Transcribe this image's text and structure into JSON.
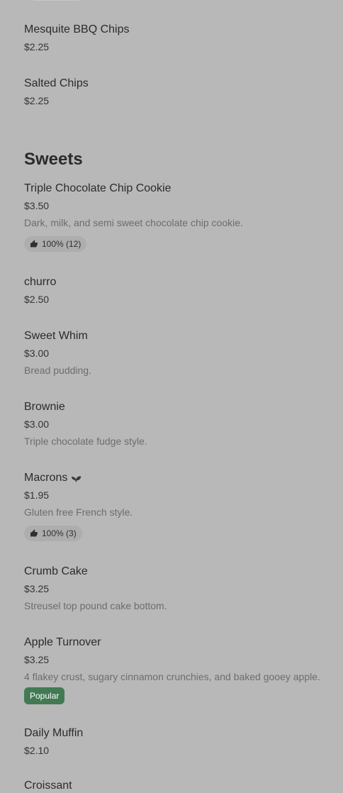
{
  "items_before": [
    {
      "name": "Mesquite BBQ Chips",
      "price": "$2.25"
    },
    {
      "name": "Salted Chips",
      "price": "$2.25"
    }
  ],
  "section": {
    "title": "Sweets"
  },
  "sweets": [
    {
      "name": "Triple Chocolate Chip Cookie",
      "price": "$3.50",
      "description": "Dark, milk, and semi sweet chocolate chip cookie.",
      "rating": "100% (12)"
    },
    {
      "name": "churro",
      "price": "$2.50"
    },
    {
      "name": "Sweet Whim",
      "price": "$3.00",
      "description": "Bread pudding."
    },
    {
      "name": "Brownie",
      "price": "$3.00",
      "description": "Triple chocolate fudge style."
    },
    {
      "name": "Macrons",
      "price": "$1.95",
      "description": "Gluten free French style.",
      "rating": "100% (3)",
      "icon": "leaf-icon"
    },
    {
      "name": "Crumb Cake",
      "price": "$3.25",
      "description": "Streusel top pound cake bottom."
    },
    {
      "name": "Apple Turnover",
      "price": "$3.25",
      "description": "4 flakey crust, sugary cinnamon crunchies, and baked gooey apple.",
      "badge": "Popular"
    },
    {
      "name": "Daily Muffin",
      "price": "$2.10"
    },
    {
      "name": "Croissant"
    }
  ],
  "colors": {
    "background": "#b8b8b8",
    "popular_badge": "#427b53",
    "rating_badge": "#adadad"
  }
}
